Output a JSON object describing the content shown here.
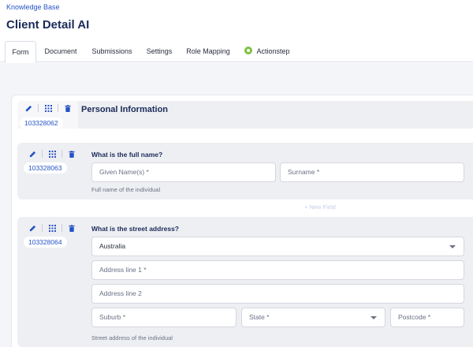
{
  "breadcrumb": "Knowledge Base",
  "page_title": "Client Detail AI",
  "tabs": [
    {
      "label": "Form"
    },
    {
      "label": "Document"
    },
    {
      "label": "Submissions"
    },
    {
      "label": "Settings"
    },
    {
      "label": "Role Mapping"
    },
    {
      "label": "Actionstep"
    }
  ],
  "section": {
    "id": "103328062",
    "title": "Personal Information"
  },
  "q1": {
    "id": "103328063",
    "question": "What is the full name?",
    "given_placeholder": "Given Name(s) *",
    "surname_placeholder": "Surname *",
    "helper": "Full name of the individual"
  },
  "new_field_label": "+  New Field",
  "q2": {
    "id": "103328064",
    "question": "What is the street address?",
    "country_value": "Australia",
    "line1_placeholder": "Address line 1 *",
    "line2_placeholder": "Address line 2",
    "suburb_placeholder": "Suburb *",
    "state_placeholder": "State *",
    "postcode_placeholder": "Postcode *",
    "helper": "Street address of the individual"
  },
  "colors": {
    "accent": "#2553c4",
    "title": "#1b2a5a",
    "block_bg": "#eeeff2",
    "actionstep": "#7cc243"
  },
  "icons": [
    "edit-pencil-icon",
    "drag-grid-icon",
    "delete-trash-icon",
    "actionstep-logo-icon",
    "chevron-down-icon"
  ]
}
